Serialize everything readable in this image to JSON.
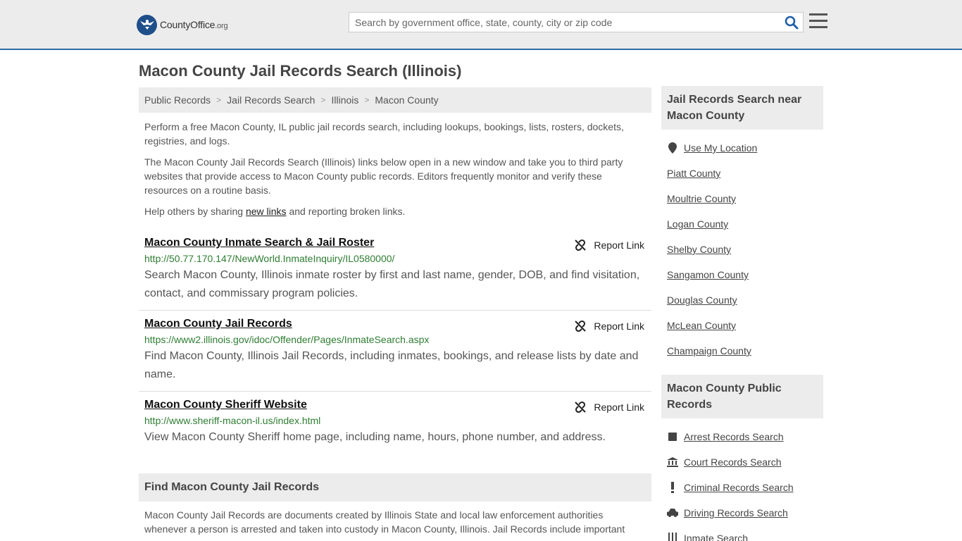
{
  "brand": {
    "name": "CountyOffice",
    "tld": ".org"
  },
  "search": {
    "placeholder": "Search by government office, state, county, city or zip code"
  },
  "page_title": "Macon County Jail Records Search (Illinois)",
  "breadcrumb": [
    "Public Records",
    "Jail Records Search",
    "Illinois",
    "Macon County"
  ],
  "intro": {
    "p1": "Perform a free Macon County, IL public jail records search, including lookups, bookings, lists, rosters, dockets, registries, and logs.",
    "p2": "The Macon County Jail Records Search (Illinois) links below open in a new window and take you to third party websites that provide access to Macon County public records. Editors frequently monitor and verify these resources on a routine basis.",
    "p3_before": "Help others by sharing ",
    "p3_link": "new links",
    "p3_after": " and reporting broken links."
  },
  "report_label": "Report Link",
  "results": [
    {
      "title": "Macon County Inmate Search & Jail Roster",
      "url": "http://50.77.170.147/NewWorld.InmateInquiry/IL0580000/",
      "desc": "Search Macon County, Illinois inmate roster by first and last name, gender, DOB, and find visitation, contact, and commissary program policies."
    },
    {
      "title": "Macon County Jail Records",
      "url": "https://www2.illinois.gov/idoc/Offender/Pages/InmateSearch.aspx",
      "desc": "Find Macon County, Illinois Jail Records, including inmates, bookings, and release lists by date and name."
    },
    {
      "title": "Macon County Sheriff Website",
      "url": "http://www.sheriff-macon-il.us/index.html",
      "desc": "View Macon County Sheriff home page, including name, hours, phone number, and address."
    }
  ],
  "find": {
    "heading": "Find Macon County Jail Records",
    "text": "Macon County Jail Records are documents created by Illinois State and local law enforcement authorities whenever a person is arrested and taken into custody in Macon County, Illinois. Jail Records include important"
  },
  "sidebar": {
    "nearby_heading": "Jail Records Search near Macon County",
    "use_location": "Use My Location",
    "nearby": [
      "Piatt County",
      "Moultrie County",
      "Logan County",
      "Shelby County",
      "Sangamon County",
      "Douglas County",
      "McLean County",
      "Champaign County"
    ],
    "public_heading": "Macon County Public Records",
    "public": [
      {
        "label": "Arrest Records Search",
        "icon": "square-icon"
      },
      {
        "label": "Court Records Search",
        "icon": "courthouse-icon"
      },
      {
        "label": "Criminal Records Search",
        "icon": "exclamation-icon"
      },
      {
        "label": "Driving Records Search",
        "icon": "car-icon"
      },
      {
        "label": "Inmate Search",
        "icon": "inmate-icon"
      }
    ]
  },
  "colors": {
    "accent": "#2e6da4",
    "url_green": "#2e7d32",
    "panel": "#ececec"
  }
}
